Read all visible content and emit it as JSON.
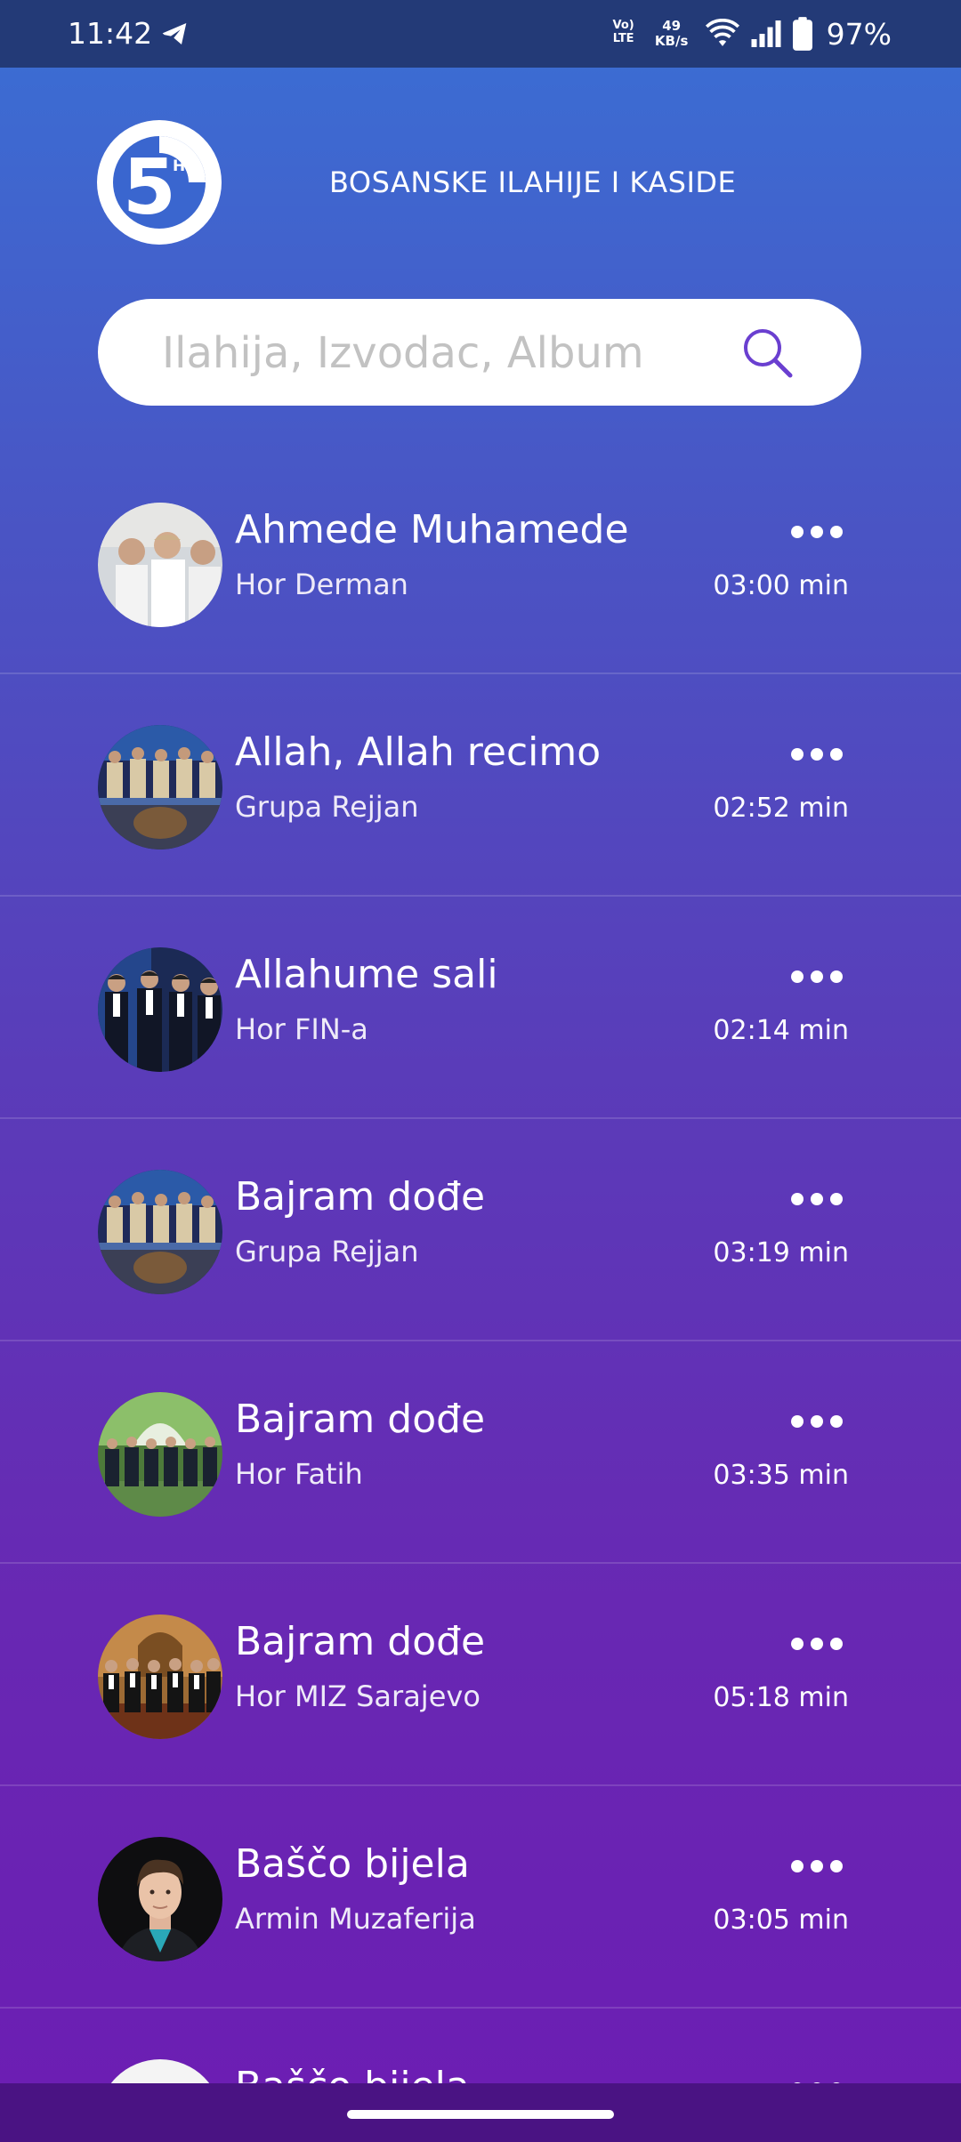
{
  "status_bar": {
    "time": "11:42",
    "volte_line1": "Vo)",
    "volte_line2": "LTE",
    "net_speed_value": "49",
    "net_speed_unit": "KB/s",
    "battery": "97%"
  },
  "header": {
    "logo_text": "5",
    "logo_badge": "HD",
    "title": "BOSANSKE ILAHIJE I KASIDE"
  },
  "search": {
    "placeholder": "Ilahija, Izvodac, Album",
    "value": ""
  },
  "songs": [
    {
      "title": "Ahmede Muhamede",
      "artist": "Hor Derman",
      "duration": "03:00 min",
      "thumb": "white-choir"
    },
    {
      "title": "Allah, Allah recimo",
      "artist": "Grupa Rejjan",
      "duration": "02:52 min",
      "thumb": "stage-group"
    },
    {
      "title": "Allahume sali",
      "artist": "Hor FIN-a",
      "duration": "02:14 min",
      "thumb": "dark-suits"
    },
    {
      "title": "Bajram dođe",
      "artist": "Grupa Rejjan",
      "duration": "03:19 min",
      "thumb": "stage-group"
    },
    {
      "title": "Bajram dođe",
      "artist": "Hor Fatih",
      "duration": "03:35 min",
      "thumb": "garden-choir"
    },
    {
      "title": "Bajram dođe",
      "artist": "Hor MIZ Sarajevo",
      "duration": "05:18 min",
      "thumb": "mosque-choir"
    },
    {
      "title": "Baščo bijela",
      "artist": "Armin Muzaferija",
      "duration": "03:05 min",
      "thumb": "portrait"
    },
    {
      "title": "Baščo bijela",
      "artist": "",
      "duration": "",
      "thumb": "portrait-light"
    }
  ],
  "colors": {
    "status_bar": "#233a77",
    "gradient_top": "#3a6fd4",
    "gradient_bottom": "#6c1db3",
    "accent": "#6a3fd0",
    "nav_bar": "#4a1383"
  }
}
